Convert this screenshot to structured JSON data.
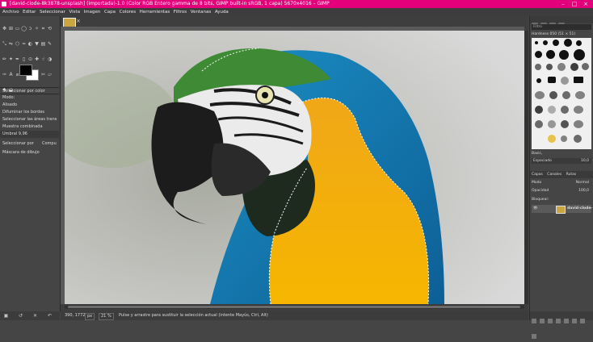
{
  "window": {
    "title": "[david-clode-8k3878-unsplash] (importada)-1.0 (Color RGB Entero gamma de 8 bits, GIMP built-in sRGB, 1 capa) 5670x4016 – GIMP",
    "controls": [
      "–",
      "□",
      "×"
    ]
  },
  "menu": [
    "Archivo",
    "Editar",
    "Seleccionar",
    "Vista",
    "Imagen",
    "Capa",
    "Colores",
    "Herramientas",
    "Filtros",
    "Ventanas",
    "Ayuda"
  ],
  "tool_options": {
    "header": "Seleccionar por color",
    "mode_label": "Modo:",
    "antialias": "Alisado",
    "feather": "Difuminar los bordes",
    "transparent": "Seleccionar las áreas trans",
    "sample_merged": "Muestra combinada",
    "threshold": "Umbral 9,96",
    "select_by_label": "Seleccionar por",
    "select_by_value": "Compu",
    "draw_mask": "Máscara de dibujo"
  },
  "status": {
    "coords": "390, 1772",
    "unit": "px",
    "zoom": "21 %",
    "message": "Pulse y arrastre para sustituir la selección actual (intente Mayús, Ctrl, Alt)"
  },
  "brushes": {
    "filter_placeholder": "Filtro",
    "current": "Hardness 050 (51 × 51)",
    "tag": "Basic,",
    "spacing_label": "Espaciado",
    "spacing_value": "10,0"
  },
  "layers": {
    "tabs": [
      "Capas",
      "Canales",
      "Rutas"
    ],
    "mode_label": "Modo",
    "mode_value": "Normal",
    "opacity_label": "Opacidad",
    "opacity_value": "100,0",
    "lock_label": "Bloquear:",
    "items": [
      {
        "name": "david-clode-"
      }
    ]
  },
  "colors": {
    "accent": "#e3007a",
    "fg": "#000000",
    "bg": "#ffffff"
  }
}
